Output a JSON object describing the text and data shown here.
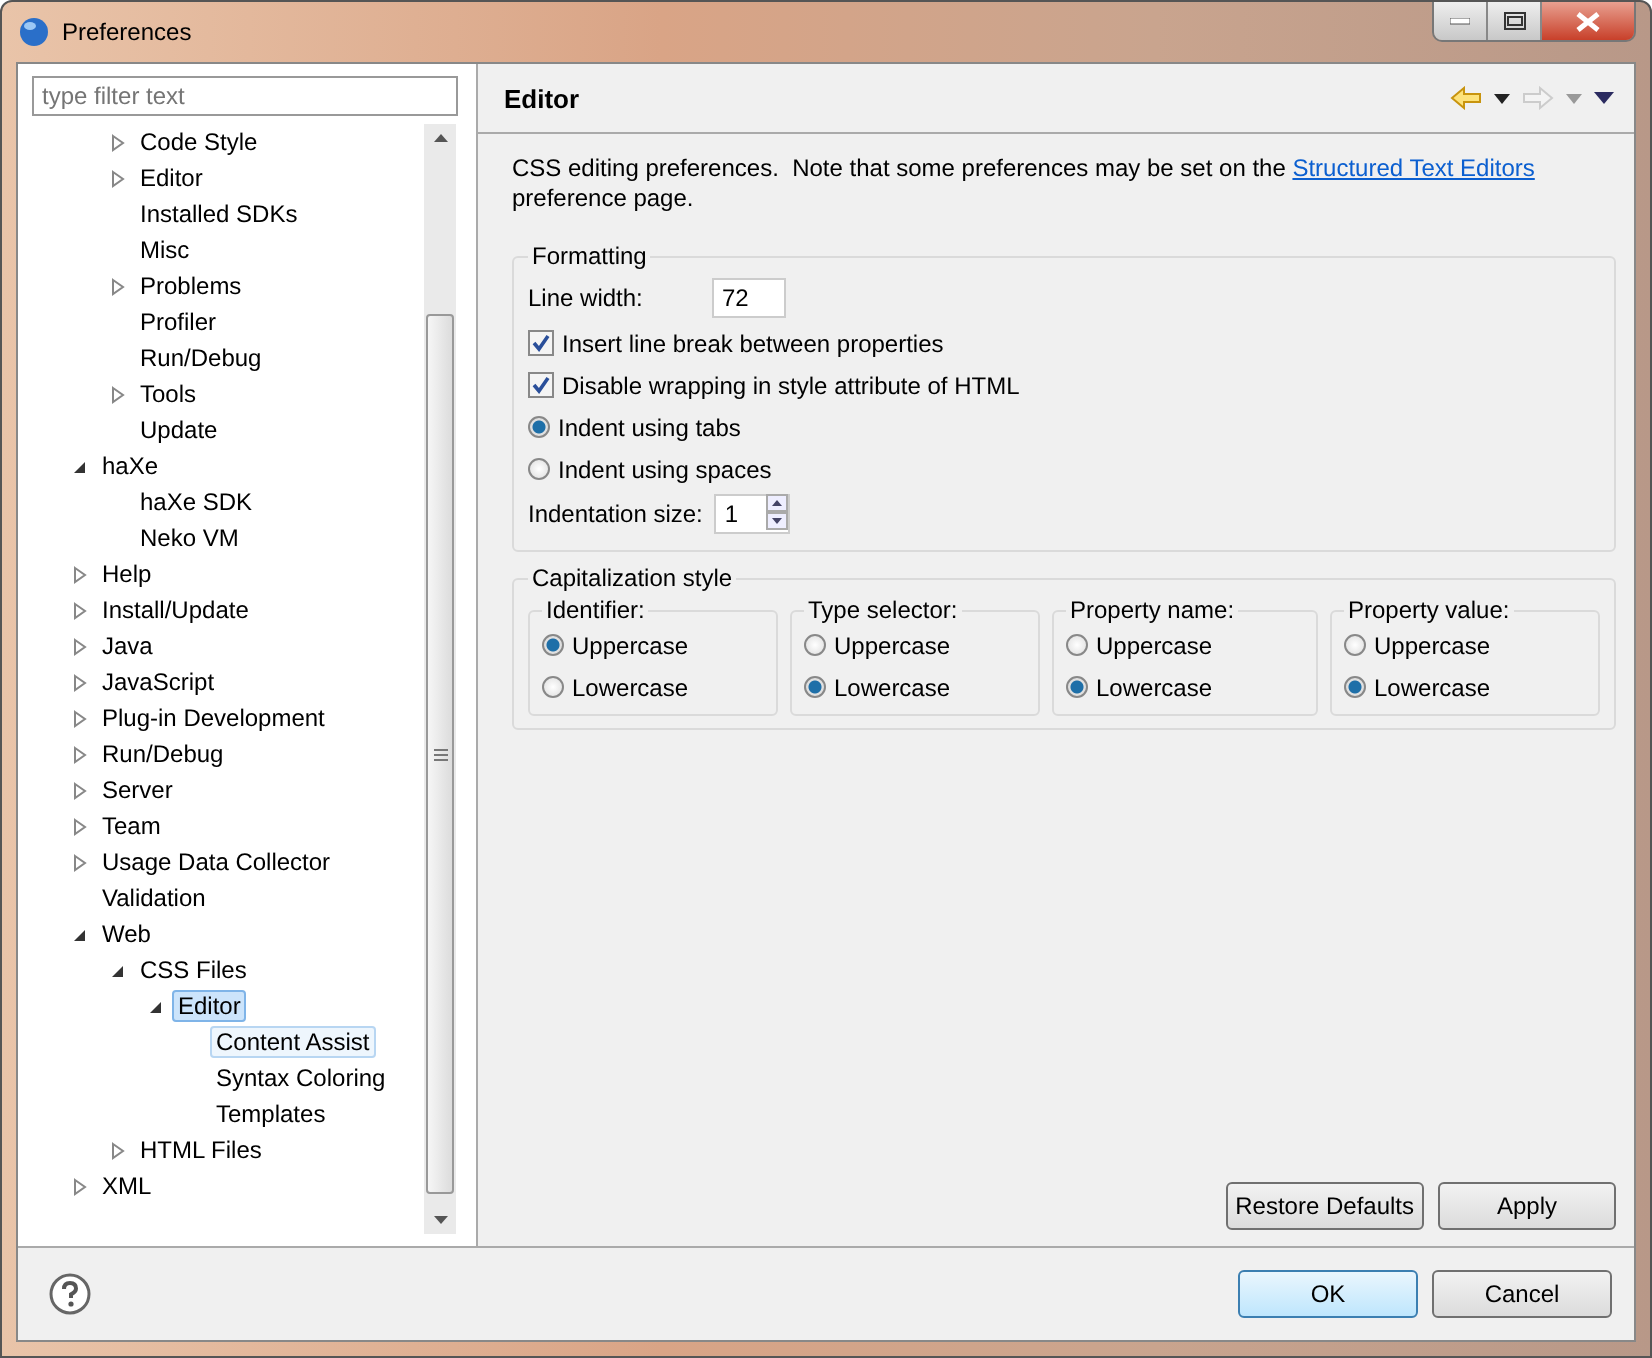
{
  "window": {
    "title": "Preferences"
  },
  "filter": {
    "placeholder": "type filter text"
  },
  "tree": {
    "items": [
      {
        "children": [
          {
            "label": "Code Style",
            "expanded": false,
            "selected": false,
            "hovered": false
          },
          {
            "label": "Editor",
            "expanded": false,
            "selected": false,
            "hovered": false
          },
          {
            "label": "Installed SDKs",
            "selected": false,
            "hovered": false
          },
          {
            "label": "Misc",
            "selected": false,
            "hovered": false
          },
          {
            "label": "Problems",
            "expanded": false,
            "selected": false,
            "hovered": false
          },
          {
            "label": "Profiler",
            "selected": false,
            "hovered": false
          },
          {
            "label": "Run/Debug",
            "selected": false,
            "hovered": false
          },
          {
            "label": "Tools",
            "expanded": false,
            "selected": false,
            "hovered": false
          },
          {
            "label": "Update",
            "selected": false,
            "hovered": false
          }
        ]
      },
      {
        "label": "haXe",
        "expanded": true,
        "selected": false,
        "hovered": false,
        "children": [
          {
            "label": "haXe SDK",
            "selected": false,
            "hovered": false
          },
          {
            "label": "Neko VM",
            "selected": false,
            "hovered": false
          }
        ]
      },
      {
        "label": "Help",
        "expanded": false,
        "selected": false,
        "hovered": false
      },
      {
        "label": "Install/Update",
        "expanded": false,
        "selected": false,
        "hovered": false
      },
      {
        "label": "Java",
        "expanded": false,
        "selected": false,
        "hovered": false
      },
      {
        "label": "JavaScript",
        "expanded": false,
        "selected": false,
        "hovered": false
      },
      {
        "label": "Plug-in Development",
        "expanded": false,
        "selected": false,
        "hovered": false
      },
      {
        "label": "Run/Debug",
        "expanded": false,
        "selected": false,
        "hovered": false
      },
      {
        "label": "Server",
        "expanded": false,
        "selected": false,
        "hovered": false
      },
      {
        "label": "Team",
        "expanded": false,
        "selected": false,
        "hovered": false
      },
      {
        "label": "Usage Data Collector",
        "expanded": false,
        "selected": false,
        "hovered": false
      },
      {
        "label": "Validation",
        "selected": false,
        "hovered": false
      },
      {
        "label": "Web",
        "expanded": true,
        "selected": false,
        "hovered": false,
        "children": [
          {
            "label": "CSS Files",
            "expanded": true,
            "selected": false,
            "hovered": false,
            "children": [
              {
                "label": "Editor",
                "expanded": true,
                "selected": true,
                "hovered": false,
                "children": [
                  {
                    "label": "Content Assist",
                    "selected": false,
                    "hovered": true
                  },
                  {
                    "label": "Syntax Coloring",
                    "selected": false,
                    "hovered": false
                  },
                  {
                    "label": "Templates",
                    "selected": false,
                    "hovered": false
                  }
                ]
              }
            ]
          },
          {
            "label": "HTML Files",
            "expanded": false,
            "selected": false,
            "hovered": false
          }
        ]
      },
      {
        "label": "XML",
        "expanded": false,
        "selected": false,
        "hovered": false
      }
    ]
  },
  "page": {
    "title": "Editor",
    "description": {
      "before": "CSS editing preferences.  Note that some preferences may be set on the ",
      "link": "Structured Text Editors",
      "after": " preference page."
    },
    "formatting": {
      "title": "Formatting",
      "line_width": {
        "label": "Line width:",
        "value": "72"
      },
      "options": [
        {
          "kind": "checkbox",
          "label": "Insert line break between properties",
          "checked": true
        },
        {
          "kind": "checkbox",
          "label": "Disable wrapping in style attribute of HTML",
          "checked": true
        },
        {
          "kind": "radio",
          "label": "Indent using tabs",
          "selected": true
        },
        {
          "kind": "radio",
          "label": "Indent using spaces",
          "selected": false
        }
      ],
      "indentation_size": {
        "label": "Indentation size:",
        "value": "1"
      }
    },
    "capitalization": {
      "title": "Capitalization style",
      "groups": [
        {
          "title": "Identifier:",
          "options": [
            {
              "label": "Uppercase",
              "selected": true
            },
            {
              "label": "Lowercase",
              "selected": false
            }
          ]
        },
        {
          "title": "Type selector:",
          "options": [
            {
              "label": "Uppercase",
              "selected": false
            },
            {
              "label": "Lowercase",
              "selected": true
            }
          ]
        },
        {
          "title": "Property name:",
          "options": [
            {
              "label": "Uppercase",
              "selected": false
            },
            {
              "label": "Lowercase",
              "selected": true
            }
          ]
        },
        {
          "title": "Property value:",
          "options": [
            {
              "label": "Uppercase",
              "selected": false
            },
            {
              "label": "Lowercase",
              "selected": true
            }
          ]
        }
      ]
    },
    "buttons": [
      "Restore Defaults",
      "Apply"
    ]
  },
  "footer": {
    "buttons": [
      {
        "label": "OK",
        "default": true
      },
      {
        "label": "Cancel",
        "default": false
      }
    ]
  }
}
